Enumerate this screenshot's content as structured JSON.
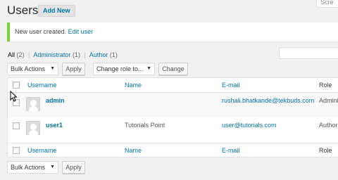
{
  "header": {
    "title": "Users",
    "add_new": "Add New",
    "screen_options": "Scre"
  },
  "notice": {
    "text": "New user created.",
    "link": "Edit user"
  },
  "filters": {
    "all_label": "All",
    "all_count": "(2)",
    "admin_label": "Administrator",
    "admin_count": "(1)",
    "author_label": "Author",
    "author_count": "(1)",
    "separator": "|"
  },
  "controls": {
    "bulk_actions": "Bulk Actions",
    "apply": "Apply",
    "change_role": "Change role to...",
    "change": "Change",
    "arrow": "▼"
  },
  "table": {
    "columns": {
      "username": "Username",
      "name": "Name",
      "email": "E-mail",
      "role": "Role"
    },
    "rows": [
      {
        "username": "admin",
        "name": "",
        "email": "rushali.bhatkande@tekbuds.com",
        "role": "Admini"
      },
      {
        "username": "user1",
        "name": "Tutorials Point",
        "email": "user@tutorials.com",
        "role": "Author"
      }
    ]
  }
}
